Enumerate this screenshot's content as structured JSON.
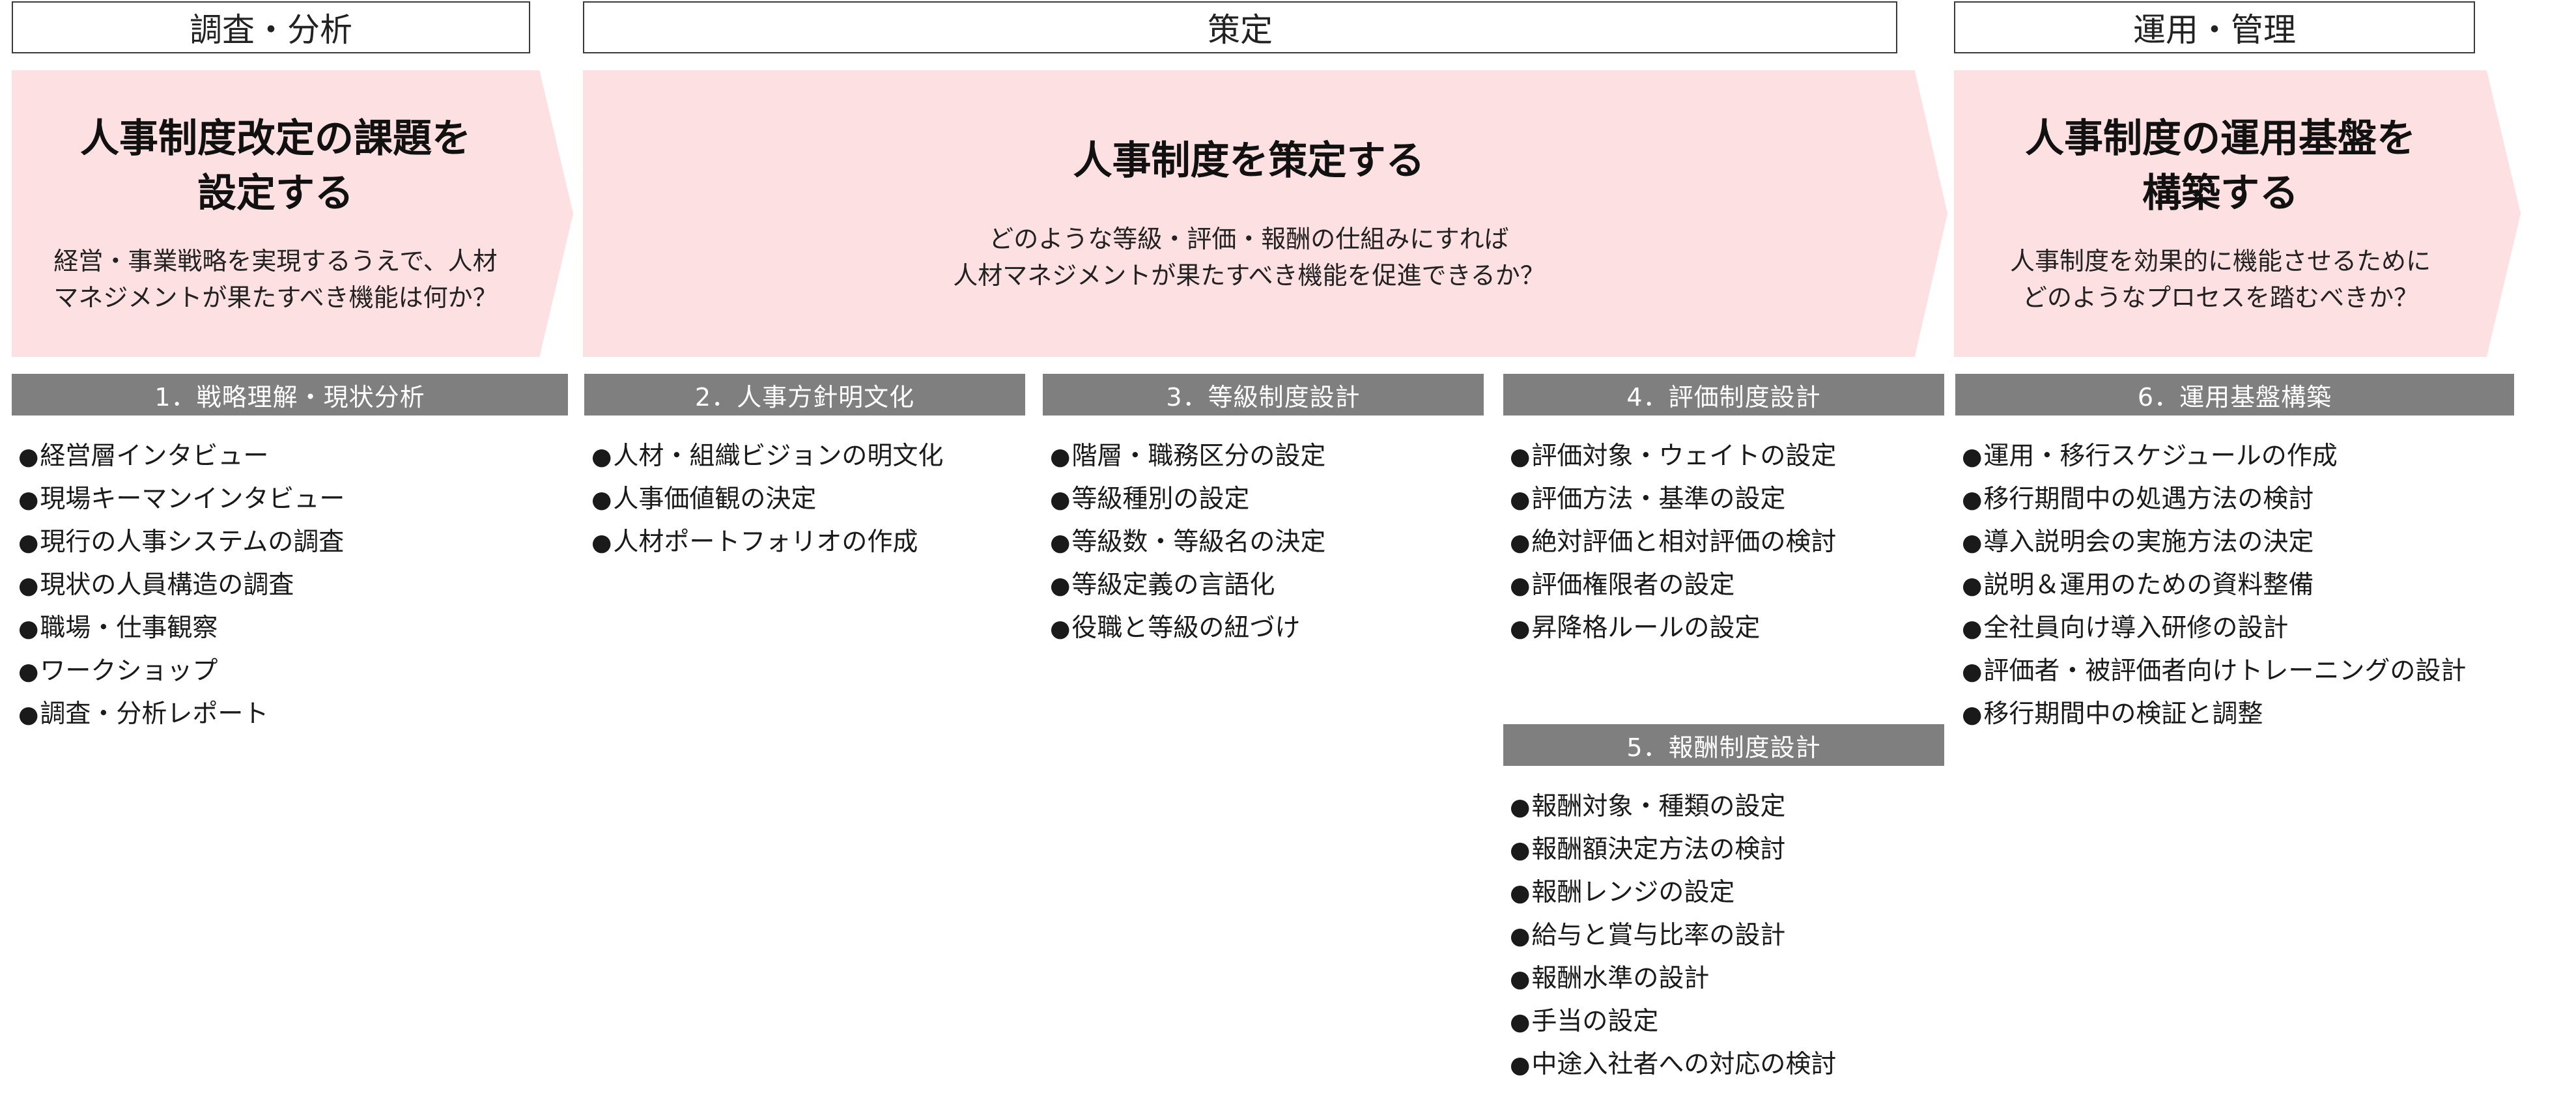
{
  "phases": [
    "調査・分析",
    "策定",
    "運用・管理"
  ],
  "arrows": [
    {
      "title_lines": [
        "人事制度改定の課題を",
        "設定する"
      ],
      "desc_lines": [
        "経営・事業戦略を実現するうえで、人材",
        "マネジメントが果たすべき機能は何か？"
      ]
    },
    {
      "title_lines": [
        "人事制度を策定する"
      ],
      "desc_lines": [
        "どのような等級・評価・報酬の仕組みにすれば",
        "人材マネジメントが果たすべき機能を促進できるか？"
      ]
    },
    {
      "title_lines": [
        "人事制度の運用基盤を",
        "構築する"
      ],
      "desc_lines": [
        "人事制度を効果的に機能させるために",
        "どのようなプロセスを踏むべきか？"
      ]
    }
  ],
  "bullet_glyph": "●",
  "sections": [
    {
      "header": "1．戦略理解・現状分析",
      "items": [
        "経営層インタビュー",
        "現場キーマンインタビュー",
        "現行の人事システムの調査",
        "現状の人員構造の調査",
        "職場・仕事観察",
        "ワークショップ",
        "調査・分析レポート"
      ]
    },
    {
      "header": "2．人事方針明文化",
      "items": [
        "人材・組織ビジョンの明文化",
        "人事価値観の決定",
        "人材ポートフォリオの作成"
      ]
    },
    {
      "header": "3．等級制度設計",
      "items": [
        "階層・職務区分の設定",
        "等級種別の設定",
        "等級数・等級名の決定",
        "等級定義の言語化",
        "役職と等級の紐づけ"
      ]
    },
    {
      "header": "4．評価制度設計",
      "items": [
        "評価対象・ウェイトの設定",
        "評価方法・基準の設定",
        "絶対評価と相対評価の検討",
        "評価権限者の設定",
        "昇降格ルールの設定"
      ]
    },
    {
      "header": "5．報酬制度設計",
      "items": [
        "報酬対象・種類の設定",
        "報酬額決定方法の検討",
        "報酬レンジの設定",
        "給与と賞与比率の設計",
        "報酬水準の設計",
        "手当の設定",
        "中途入社者への対応の検討"
      ]
    },
    {
      "header": "6．運用基盤構築",
      "items": [
        "運用・移行スケジュールの作成",
        "移行期間中の処遇方法の検討",
        "導入説明会の実施方法の決定",
        "説明＆運用のための資料整備",
        "全社員向け導入研修の設計",
        "評価者・被評価者向けトレーニングの設計",
        "移行期間中の検証と調整"
      ]
    }
  ]
}
